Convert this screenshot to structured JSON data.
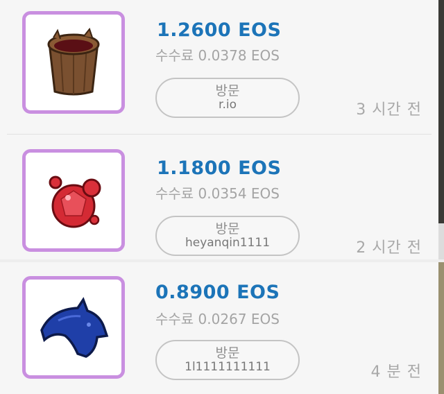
{
  "items": [
    {
      "image_icon": "wooden-bucket-icon",
      "price": "1.2600 EOS",
      "fee": "수수료 0.0378 EOS",
      "visit_label": "방문",
      "seller": "r.io",
      "time_ago": "3 시간 전"
    },
    {
      "image_icon": "red-gem-icon",
      "price": "1.1800 EOS",
      "fee": "수수료 0.0354 EOS",
      "visit_label": "방문",
      "seller": "heyanqin1111",
      "time_ago": "2 시간 전"
    },
    {
      "image_icon": "blue-helmet-icon",
      "price": "0.8900 EOS",
      "fee": "수수료 0.0267 EOS",
      "visit_label": "방문",
      "seller": "1l1111111111",
      "time_ago": "4 분 전"
    }
  ],
  "colors": {
    "price": "#1c74b8",
    "thumb_border": "#c98fe0",
    "muted_text": "#a4a4a4"
  }
}
